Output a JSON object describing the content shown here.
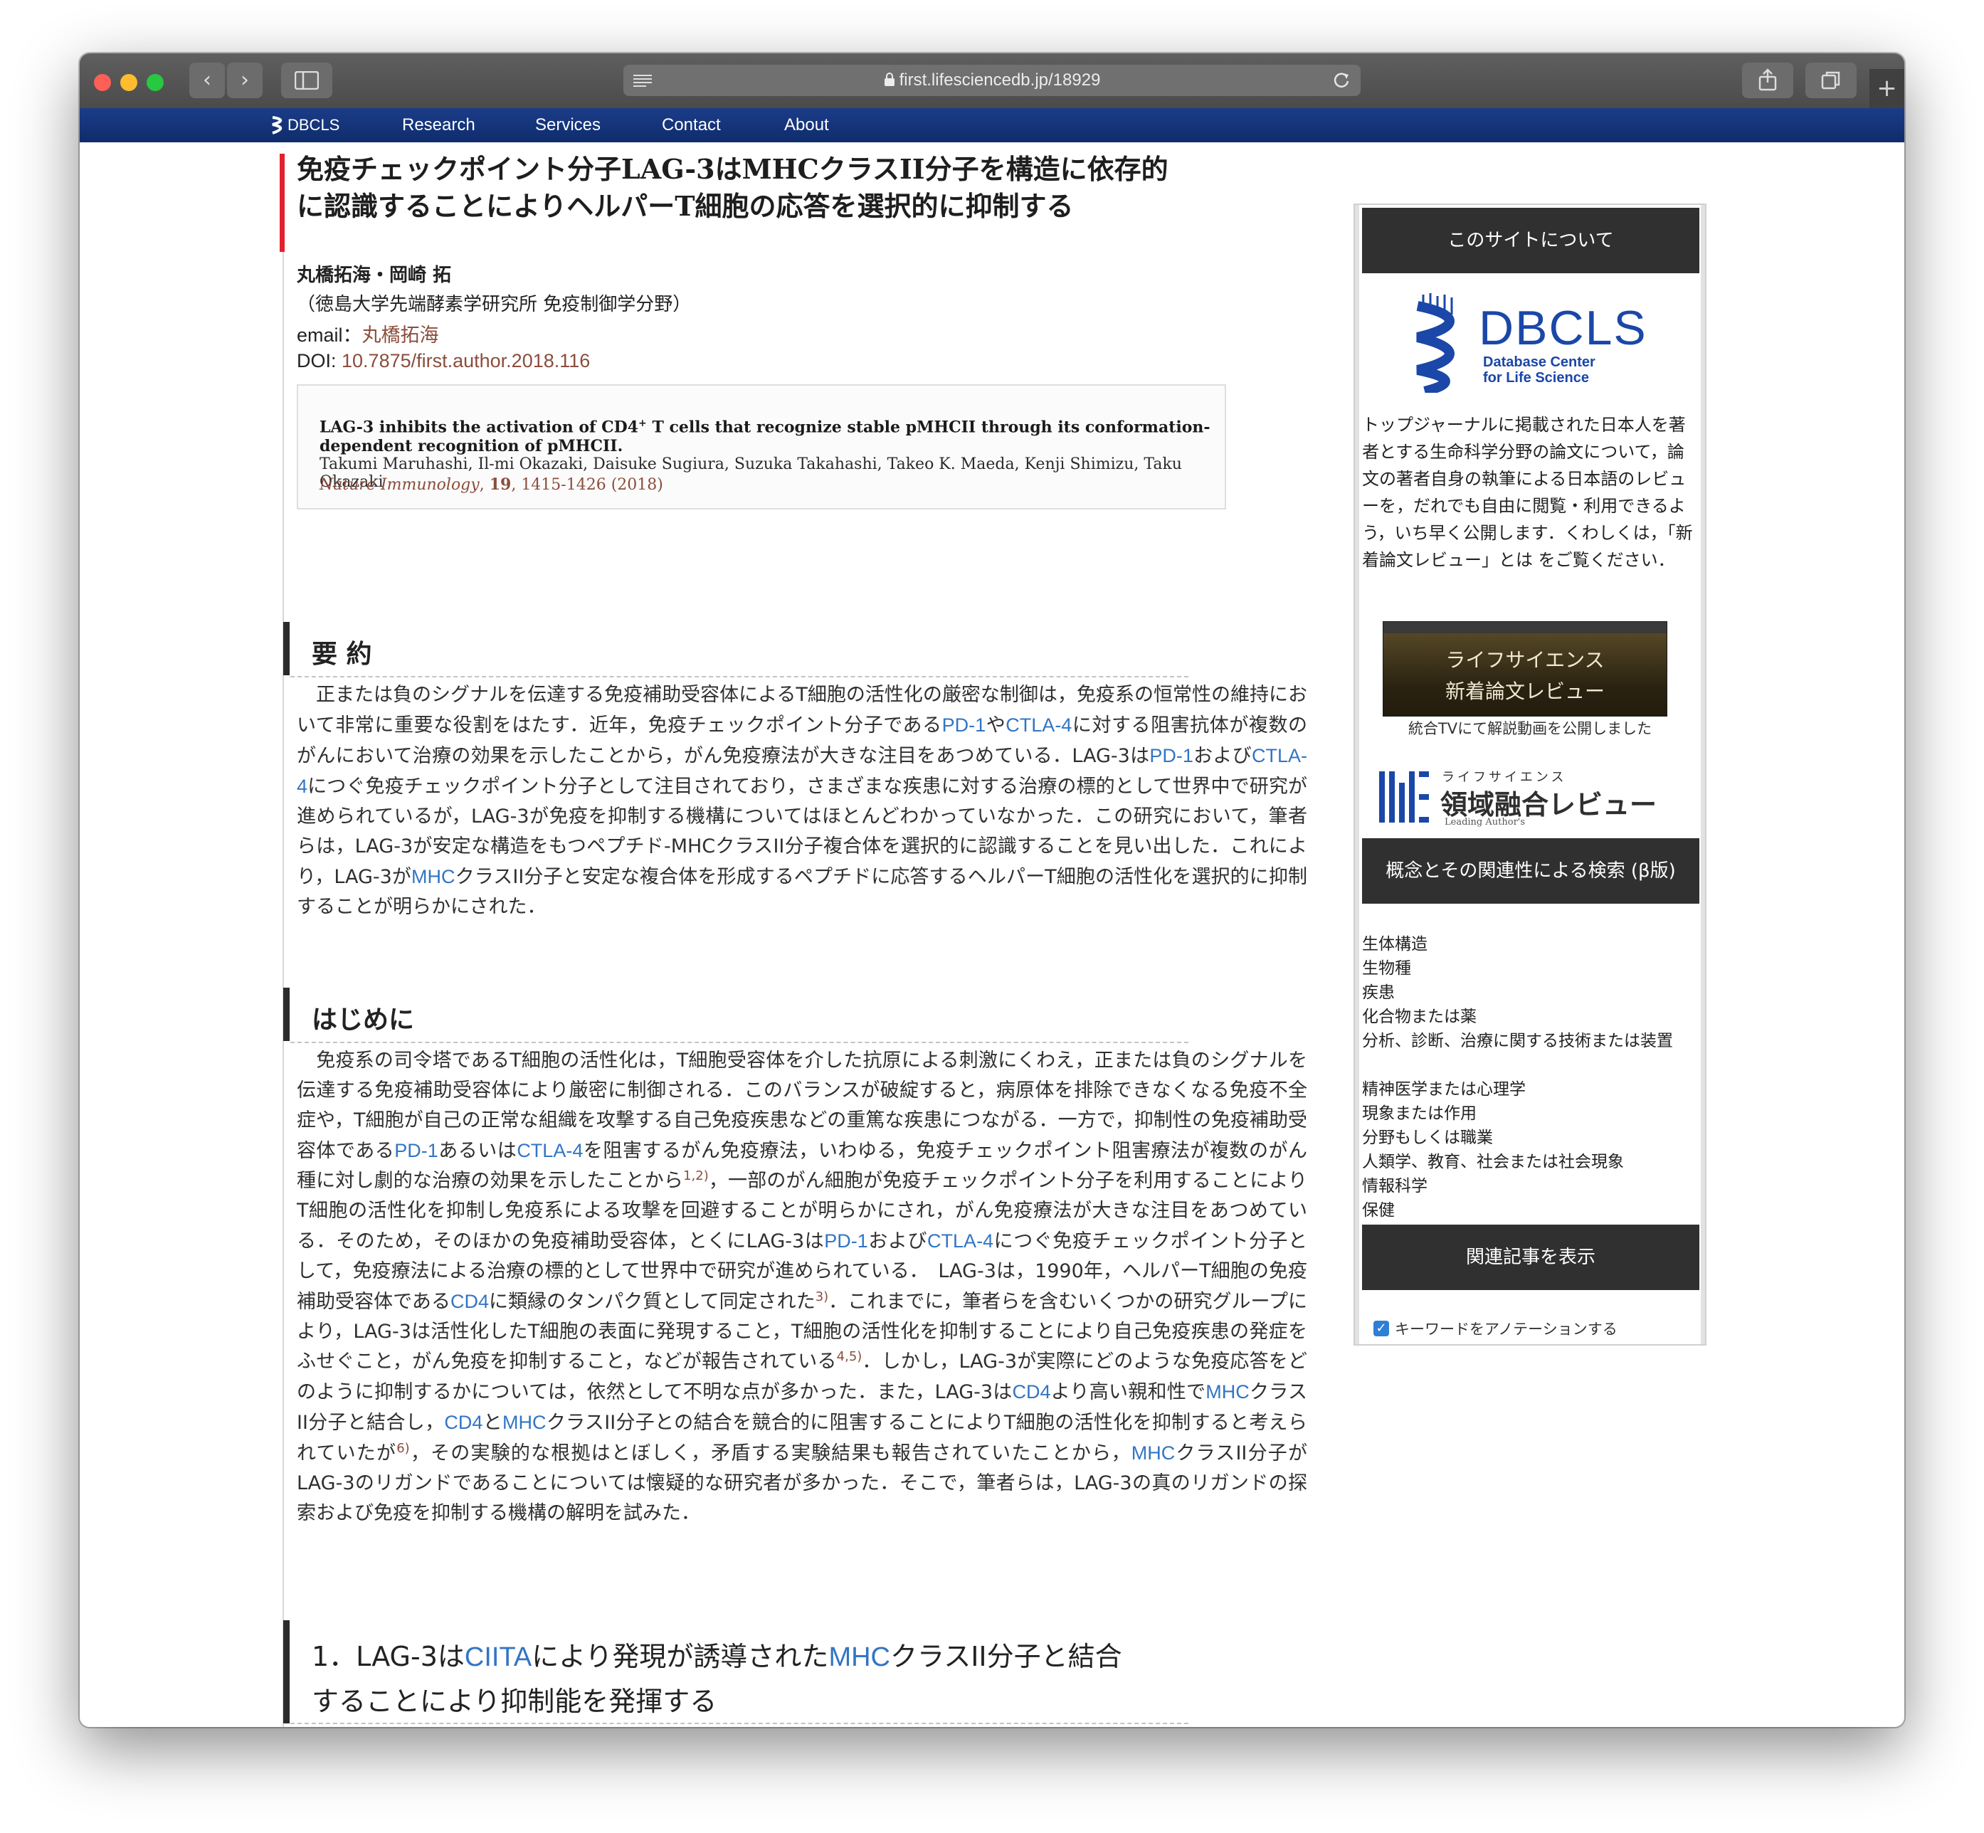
{
  "browser": {
    "url": "first.lifesciencedb.jp/18929",
    "back_icon": "‹",
    "forward_icon": "›",
    "new_tab_icon": "+"
  },
  "nav": {
    "logo": "DBCLS",
    "items": [
      "Research",
      "Services",
      "Contact",
      "About"
    ]
  },
  "article": {
    "title_line1": "免疫チェックポイント分子LAG-3はMHCクラスII分子を構造に依存的",
    "title_line2": "に認識することによりヘルパーT細胞の応答を選択的に抑制する",
    "authors": "丸橋拓海・岡崎 拓",
    "affiliation": "（徳島大学先端酵素学研究所 免疫制御学分野）",
    "email_label": "email：",
    "email_name": "丸橋拓海",
    "doi_label": "DOI: ",
    "doi": "10.7875/first.author.2018.116",
    "citation": {
      "title_pre": "LAG-3 inhibits the activation of CD4",
      "title_sup": "+",
      "title_post": " T cells that recognize stable pMHCII through its conformation-dependent recognition of pMHCII.",
      "authors": "Takumi Maruhashi, Il-mi Okazaki, Daisuke Sugiura, Suzuka Takahashi, Takeo K. Maeda, Kenji Shimizu, Taku Okazaki",
      "journal": "Nature Immunology",
      "volume": "19",
      "pages": ", 1415-1426 (2018)"
    }
  },
  "sections": {
    "summary_title": "要 約",
    "summary": [
      {
        "t": "　正または負のシグナルを伝達する免疫補助受容体によるT細胞の活性化の厳密な制御は，免疫系の恒常性の維持において非常に重要な役割をはたす．近年，免疫チェックポイント分子である"
      },
      {
        "k": "PD-1"
      },
      {
        "t": "や"
      },
      {
        "k": "CTLA-4"
      },
      {
        "t": "に対する阻害抗体が複数のがんにおいて治療の効果を示したことから，がん免疫療法が大きな注目をあつめている．LAG-3は"
      },
      {
        "k": "PD-1"
      },
      {
        "t": "および"
      },
      {
        "k": "CTLA-4"
      },
      {
        "t": "につぐ免疫チェックポイント分子として注目されており，さまざまな疾患に対する治療の標的として世界中で研究が進められているが，LAG-3が免疫を抑制する機構についてはほとんどわかっていなかった．この研究において，筆者らは，LAG-3が安定な構造をもつペプチド-MHCクラスII分子複合体を選択的に認識することを見い出した．これにより，LAG-3が"
      },
      {
        "k": "MHC"
      },
      {
        "t": "クラスII分子と安定な複合体を形成するペプチドに応答するヘルパーT細胞の活性化を選択的に抑制することが明らかにされた．"
      }
    ],
    "intro_title": "はじめに",
    "intro": [
      {
        "t": "　免疫系の司令塔であるT細胞の活性化は，T細胞受容体を介した抗原による刺激にくわえ，正または負のシグナルを伝達する免疫補助受容体により厳密に制御される．このバランスが破綻すると，病原体を排除できなくなる免疫不全症や，T細胞が自己の正常な組織を攻撃する自己免疫疾患などの重篤な疾患につながる．一方で，抑制性の免疫補助受容体である"
      },
      {
        "k": "PD-1"
      },
      {
        "t": "あるいは"
      },
      {
        "k": "CTLA-4"
      },
      {
        "t": "を阻害するがん免疫療法，いわゆる，免疫チェックポイント阻害療法が複数のがん種に対し劇的な治療の効果を示したことから"
      },
      {
        "r": "1,2)"
      },
      {
        "t": "，一部のがん細胞が免疫チェックポイント分子を利用することによりT細胞の活性化を抑制し免疫系による攻撃を回避することが明らかにされ，がん免疫療法が大きな注目をあつめている．そのため，そのほかの免疫補助受容体，とくにLAG-3は"
      },
      {
        "k": "PD-1"
      },
      {
        "t": "および"
      },
      {
        "k": "CTLA-4"
      },
      {
        "t": "につぐ免疫チェックポイント分子として，免疫療法による治療の標的として世界中で研究が進められている．　LAG-3は，1990年，ヘルパーT細胞の免疫補助受容体である"
      },
      {
        "k": "CD4"
      },
      {
        "t": "に類縁のタンパク質として同定された"
      },
      {
        "r": "3)"
      },
      {
        "t": "．これまでに，筆者らを含むいくつかの研究グループにより，LAG-3は活性化したT細胞の表面に発現すること，T細胞の活性化を抑制することにより自己免疫疾患の発症をふせぐこと，がん免疫を抑制すること，などが報告されている"
      },
      {
        "r": "4,5)"
      },
      {
        "t": "．しかし，LAG-3が実際にどのような免疫応答をどのように抑制するかについては，依然として不明な点が多かった．また，LAG-3は"
      },
      {
        "k": "CD4"
      },
      {
        "t": "より高い親和性で"
      },
      {
        "k": "MHC"
      },
      {
        "t": "クラスII分子と結合し，"
      },
      {
        "k": "CD4"
      },
      {
        "t": "と"
      },
      {
        "k": "MHC"
      },
      {
        "t": "クラスII分子との結合を競合的に阻害することによりT細胞の活性化を抑制すると考えられていたが"
      },
      {
        "r": "6)"
      },
      {
        "t": "，その実験的な根拠はとぼしく，矛盾する実験結果も報告されていたことから，"
      },
      {
        "k": "MHC"
      },
      {
        "t": "クラスII分子がLAG-3のリガンドであることについては懐疑的な研究者が多かった．そこで，筆者らは，LAG-3の真のリガンドの探索および免疫を抑制する機構の解明を試みた．"
      }
    ],
    "section1_line1": [
      {
        "t": "1．LAG-3は"
      },
      {
        "k": "CIITA"
      },
      {
        "t": "により発現が誘導された"
      },
      {
        "k": "MHC"
      },
      {
        "t": "クラスII分子と結合"
      }
    ],
    "section1_line2": "することにより抑制能を発揮する"
  },
  "sidebar": {
    "about_header": "このサイトについて",
    "logo_main": "DBCLS",
    "logo_sub1": "Database Center",
    "logo_sub2": "for Life Science",
    "about_text": "トップジャーナルに掲載された日本人を著者とする生命科学分野の論文について，論文の著者自身の執筆による日本語のレビューを，だれでも自由に閲覧・利用できるよう，いち早く公開します．くわしくは，「新着論文レビュー」とは をご覧ください．",
    "tv_line1": "ライフサイエンス",
    "tv_line2": "新着論文レビュー",
    "tv_caption": "統合TVにて解説動画を公開しました",
    "review_kana": "ライフサイエンス",
    "review_title": "領域融合レビュー",
    "review_sub": "Leading Author's",
    "concept_header": "概念とその関連性による検索 (β版)",
    "concepts": [
      "生体構造",
      "生物種",
      "疾患",
      "化合物または薬",
      "分析、診断、治療に関する技術または装置",
      "精神医学または心理学",
      "現象または作用",
      "分野もしくは職業",
      "人類学、教育、社会または社会現象",
      "情報科学",
      "保健"
    ],
    "related_header": "関連記事を表示",
    "annotate_label": "キーワードをアノテーションする"
  },
  "colors": {
    "nav_bg": "#163578",
    "accent_red": "#e3202d",
    "keyword_blue": "#3275c4",
    "link_brown": "#8b4d3c",
    "sidebar_header": "#303030",
    "dbcls_blue": "#1a47a8"
  }
}
